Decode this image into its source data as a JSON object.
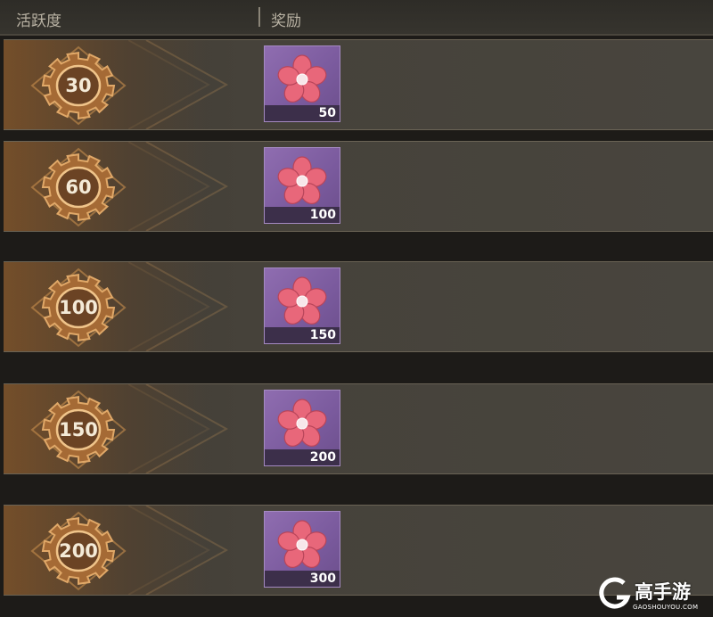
{
  "header": {
    "col_activity": "活跃度",
    "col_reward": "奖励"
  },
  "rows": [
    {
      "activity": "30",
      "reward_qty": "50"
    },
    {
      "activity": "60",
      "reward_qty": "100"
    },
    {
      "activity": "100",
      "reward_qty": "150"
    },
    {
      "activity": "150",
      "reward_qty": "200"
    },
    {
      "activity": "200",
      "reward_qty": "300"
    }
  ],
  "icons": {
    "gear": "gear-badge-icon",
    "reward": "pink-flower-icon"
  },
  "colors": {
    "gear": "#c98a4a",
    "item_bg": "#7a5a9d",
    "flower": "#e8677a"
  },
  "watermark": {
    "brand": "高手游",
    "domain": "GAOSHOUYOU.COM"
  }
}
